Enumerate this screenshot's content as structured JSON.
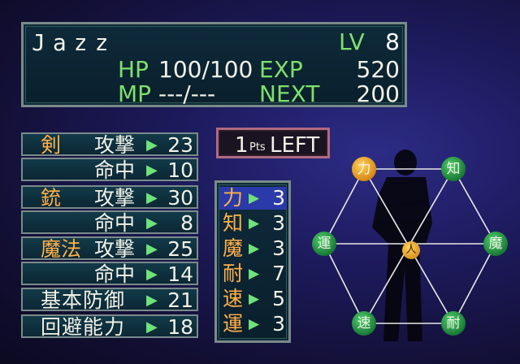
{
  "character": {
    "name": "Jazz",
    "level_label": "LV",
    "level": "8",
    "hp_label": "HP",
    "hp": "100/100",
    "mp_label": "MP",
    "mp": "---/---",
    "exp_label": "EXP",
    "exp": "520",
    "next_label": "NEXT",
    "next": "200"
  },
  "combat_stats": [
    {
      "category": "剣",
      "label": "攻撃",
      "value": "23"
    },
    {
      "category": "",
      "label": "命中",
      "value": "10"
    },
    {
      "category": "銃",
      "label": "攻撃",
      "value": "30"
    },
    {
      "category": "",
      "label": "命中",
      "value": "8"
    },
    {
      "category": "魔法",
      "label": "攻撃",
      "value": "25"
    },
    {
      "category": "",
      "label": "命中",
      "value": "14"
    },
    {
      "category": "",
      "label": "基本防御",
      "value": "21"
    },
    {
      "category": "",
      "label": "回避能力",
      "value": "18"
    }
  ],
  "points": {
    "count": "1",
    "unit": "Pts",
    "label": "LEFT"
  },
  "attributes": [
    {
      "key": "力",
      "value": "3",
      "selected": true
    },
    {
      "key": "知",
      "value": "3",
      "selected": false
    },
    {
      "key": "魔",
      "value": "3",
      "selected": false
    },
    {
      "key": "耐",
      "value": "7",
      "selected": false
    },
    {
      "key": "速",
      "value": "5",
      "selected": false
    },
    {
      "key": "運",
      "value": "3",
      "selected": false
    }
  ],
  "arrow_glyph": "▶",
  "hexagon": {
    "nodes": [
      "力",
      "知",
      "魔",
      "耐",
      "速",
      "運"
    ],
    "selected": "力",
    "center_symbol": "人",
    "line_color": "#e8e8e8",
    "node_color": "#2fa84a",
    "selected_color": "#e8a020"
  },
  "colors": {
    "label_green": "#7ee06a",
    "category_orange": "#ffb04a",
    "highlight_blue": "#2a3aa8"
  }
}
